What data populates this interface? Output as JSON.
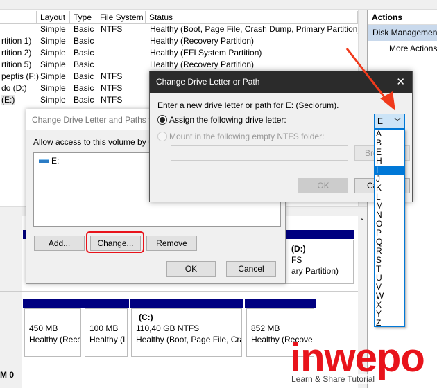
{
  "volume_list": {
    "columns": [
      "Layout",
      "Type",
      "File System",
      "Status"
    ],
    "rows": [
      {
        "name": "",
        "layout": "Simple",
        "type": "Basic",
        "fs": "NTFS",
        "status": "Healthy (Boot, Page File, Crash Dump, Primary Partition)"
      },
      {
        "name": "rtition 1)",
        "layout": "Simple",
        "type": "Basic",
        "fs": "",
        "status": "Healthy (Recovery Partition)"
      },
      {
        "name": "rtition 2)",
        "layout": "Simple",
        "type": "Basic",
        "fs": "",
        "status": "Healthy (EFI System Partition)"
      },
      {
        "name": "rtition 5)",
        "layout": "Simple",
        "type": "Basic",
        "fs": "",
        "status": "Healthy (Recovery Partition)"
      },
      {
        "name": "peptis (F:)",
        "layout": "Simple",
        "type": "Basic",
        "fs": "NTFS",
        "status": ""
      },
      {
        "name": "do (D:)",
        "layout": "Simple",
        "type": "Basic",
        "fs": "NTFS",
        "status": ""
      },
      {
        "name": "(E:)",
        "layout": "Simple",
        "type": "Basic",
        "fs": "NTFS",
        "status": ""
      }
    ]
  },
  "actions": {
    "title": "Actions",
    "section": "Disk Management",
    "more": "More Actions"
  },
  "disk_top": {
    "d_label": "(D:)",
    "d_fs": "FS",
    "d_status": "ary Partition)"
  },
  "disk0": {
    "label": "M 0",
    "partitions": [
      {
        "title": "",
        "size": "450 MB",
        "status": "Healthy (Reco"
      },
      {
        "title": "",
        "size": "100 MB",
        "status": "Healthy (I"
      },
      {
        "title": "(C:)",
        "size": "110,40 GB NTFS",
        "status": "Healthy (Boot, Page File, Cra"
      },
      {
        "title": "",
        "size": "852 MB",
        "status": "Healthy (Recove"
      }
    ]
  },
  "paths_dialog": {
    "title": "Change Drive Letter and Paths fo",
    "prompt": "Allow access to this volume by using",
    "entry": "E:",
    "add": "Add...",
    "change": "Change...",
    "remove": "Remove",
    "ok": "OK",
    "cancel": "Cancel"
  },
  "letter_dialog": {
    "title": "Change Drive Letter or Path",
    "close": "✕",
    "prompt": "Enter a new drive letter or path for E: (Seclorum).",
    "assign": "Assign the following drive letter:",
    "mount": "Mount in the following empty NTFS folder:",
    "browse": "Bro",
    "ok": "OK",
    "cancel": "Ca",
    "selected_letter": "E",
    "options": [
      "A",
      "B",
      "E",
      "H",
      "I",
      "J",
      "K",
      "L",
      "M",
      "N",
      "O",
      "P",
      "Q",
      "R",
      "S",
      "T",
      "U",
      "V",
      "W",
      "X",
      "Y",
      "Z"
    ],
    "highlighted": "I"
  },
  "watermark": {
    "logo": "inwepo",
    "tagline": "Learn & Share Tutorial"
  },
  "colors": {
    "accent": "#0078d7",
    "highlight_red": "#e8131b",
    "disk_bar": "#000080"
  }
}
